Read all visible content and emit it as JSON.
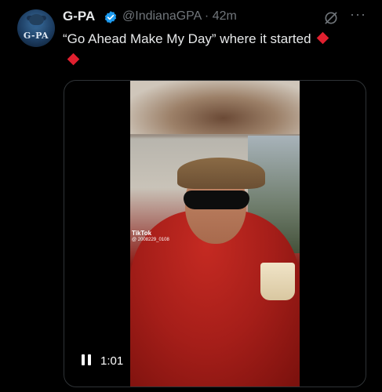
{
  "author": {
    "display_name": "G-PA",
    "avatar_text": "G-PA",
    "handle": "@IndianaGPA",
    "separator": "·",
    "time": "42m",
    "verified_color": "#1d9bf0"
  },
  "tweet": {
    "text": "“Go Ahead Make My Day” where it started",
    "emoji": "red-diamond",
    "emoji_color": "#e0202f"
  },
  "actions": {
    "grok_icon": "grok-icon",
    "more_label": "···"
  },
  "video": {
    "watermark_brand": "TikTok",
    "watermark_id": "@ 2008229_0108",
    "duration": "1:01",
    "state": "playing"
  }
}
